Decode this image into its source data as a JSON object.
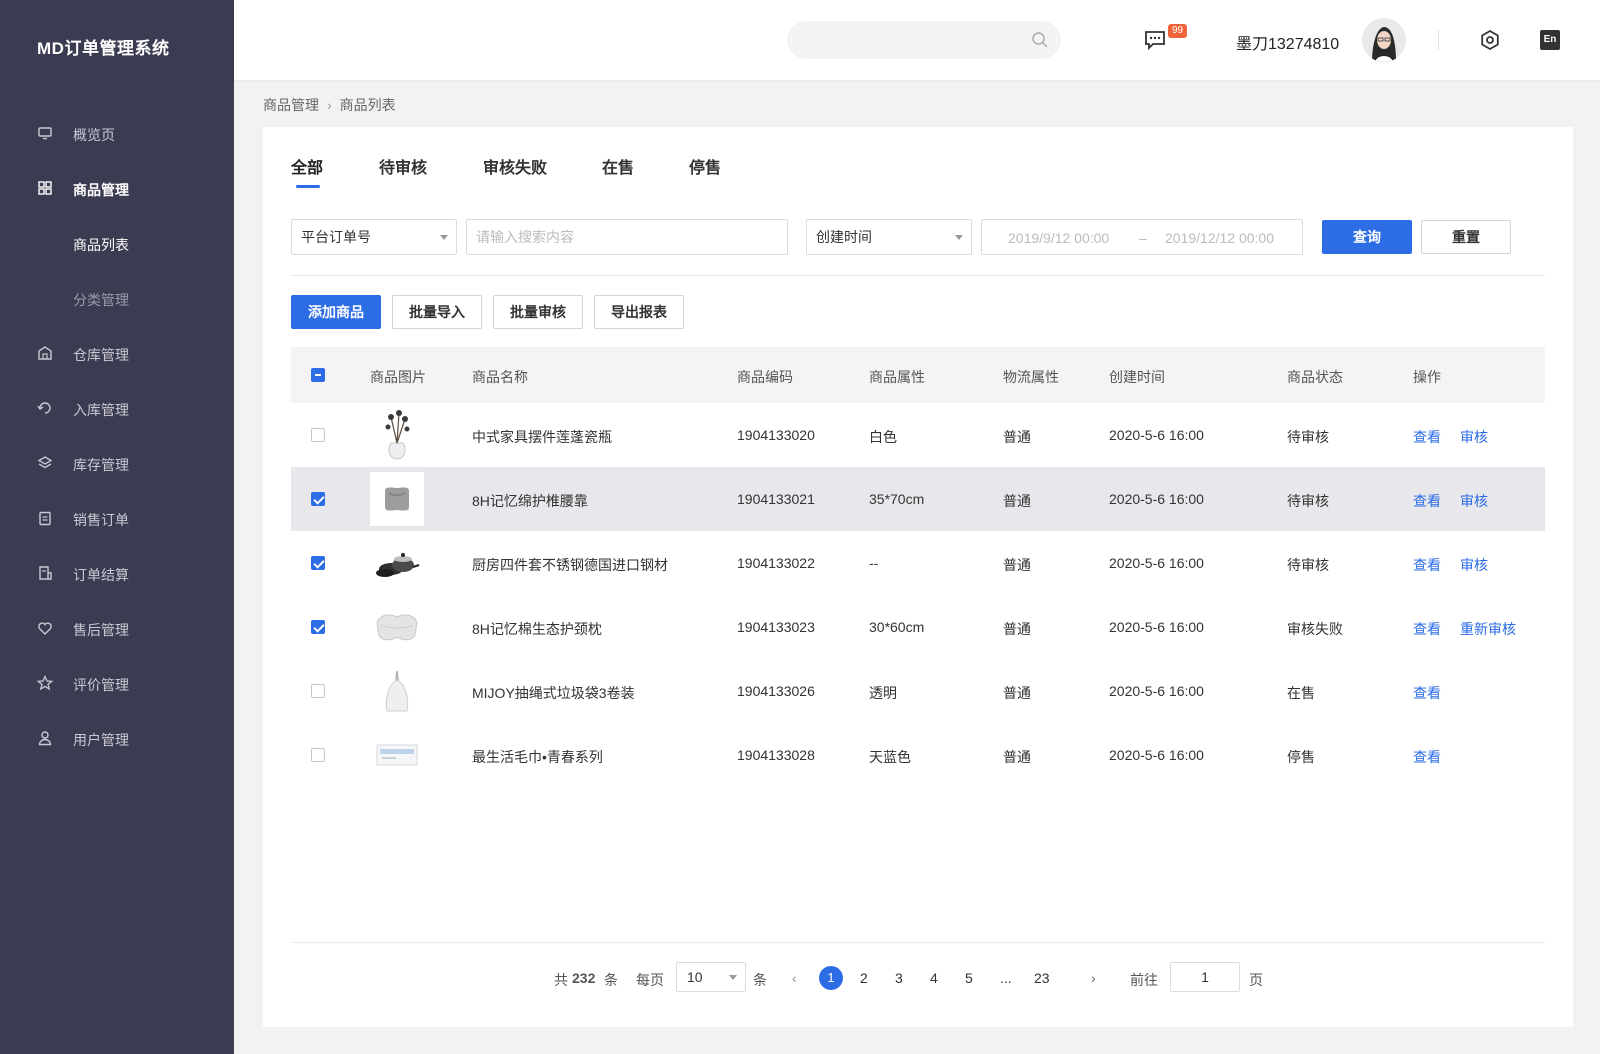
{
  "app": {
    "title": "MD订单管理系统"
  },
  "sidebar": {
    "items": [
      {
        "label": "概览页",
        "icon": "monitor-icon"
      },
      {
        "label": "商品管理",
        "icon": "grid-icon"
      },
      {
        "label": "商品列表"
      },
      {
        "label": "分类管理"
      },
      {
        "label": "仓库管理",
        "icon": "warehouse-icon"
      },
      {
        "label": "入库管理",
        "icon": "inbound-icon"
      },
      {
        "label": "库存管理",
        "icon": "layers-icon"
      },
      {
        "label": "销售订单",
        "icon": "clipboard-icon"
      },
      {
        "label": "订单结算",
        "icon": "receipt-icon"
      },
      {
        "label": "售后管理",
        "icon": "heart-icon"
      },
      {
        "label": "评价管理",
        "icon": "star-icon"
      },
      {
        "label": "用户管理",
        "icon": "user-icon"
      }
    ]
  },
  "header": {
    "search_placeholder": "",
    "badge": "99",
    "username": "墨刀13274810",
    "lang": "En"
  },
  "breadcrumb": {
    "parent": "商品管理",
    "current": "商品列表"
  },
  "tabs": [
    "全部",
    "待审核",
    "审核失败",
    "在售",
    "停售"
  ],
  "filters": {
    "order_type": "平台订单号",
    "search_placeholder": "请输入搜索内容",
    "time_type": "创建时间",
    "date_start": "2019/9/12 00:00",
    "date_sep": "–",
    "date_end": "2019/12/12 00:00",
    "query": "查询",
    "reset": "重置"
  },
  "actions": [
    "添加商品",
    "批量导入",
    "批量审核",
    "导出报表"
  ],
  "table": {
    "headers": [
      "商品图片",
      "商品名称",
      "商品编码",
      "商品属性",
      "物流属性",
      "创建时间",
      "商品状态",
      "操作"
    ],
    "rows": [
      {
        "name": "中式家具摆件莲蓬瓷瓶",
        "code": "1904133020",
        "attr": "白色",
        "logistics": "普通",
        "created": "2020-5-6  16:00",
        "status": "待审核",
        "ops": [
          "查看",
          "审核"
        ],
        "checked": false,
        "thumb": "vase-image"
      },
      {
        "name": "8H记忆绵护椎腰靠",
        "code": "1904133021",
        "attr": "35*70cm",
        "logistics": "普通",
        "created": "2020-5-6  16:00",
        "status": "待审核",
        "ops": [
          "查看",
          "审核"
        ],
        "checked": true,
        "thumb": "cushion-image"
      },
      {
        "name": "厨房四件套不锈钢德国进口钢材",
        "code": "1904133022",
        "attr": "--",
        "logistics": "普通",
        "created": "2020-5-6  16:00",
        "status": "待审核",
        "ops": [
          "查看",
          "审核"
        ],
        "checked": true,
        "thumb": "cookware-image"
      },
      {
        "name": "8H记忆棉生态护颈枕",
        "code": "1904133023",
        "attr": "30*60cm",
        "logistics": "普通",
        "created": "2020-5-6  16:00",
        "status": "审核失败",
        "ops": [
          "查看",
          "重新审核"
        ],
        "checked": true,
        "thumb": "pillow-image"
      },
      {
        "name": "MIJOY抽绳式垃圾袋3卷装",
        "code": "1904133026",
        "attr": "透明",
        "logistics": "普通",
        "created": "2020-5-6  16:00",
        "status": "在售",
        "ops": [
          "查看"
        ],
        "checked": false,
        "thumb": "trashbag-image"
      },
      {
        "name": "最生活毛巾•青春系列",
        "code": "1904133028",
        "attr": "天蓝色",
        "logistics": "普通",
        "created": "2020-5-6  16:00",
        "status": "停售",
        "ops": [
          "查看"
        ],
        "checked": false,
        "thumb": "towel-image"
      }
    ]
  },
  "pager": {
    "total_prefix": "共",
    "total": "232",
    "total_suffix": "条",
    "per_page_label": "每页",
    "per_page": "10",
    "per_page_suffix": "条",
    "pages": [
      "1",
      "2",
      "3",
      "4",
      "5",
      "...",
      "23"
    ],
    "current": "1",
    "goto_label": "前往",
    "goto_value": "1",
    "goto_suffix": "页"
  },
  "colors": {
    "accent": "#2c6ce5",
    "sidebar": "#3b3b51",
    "badge": "#f0643c"
  }
}
